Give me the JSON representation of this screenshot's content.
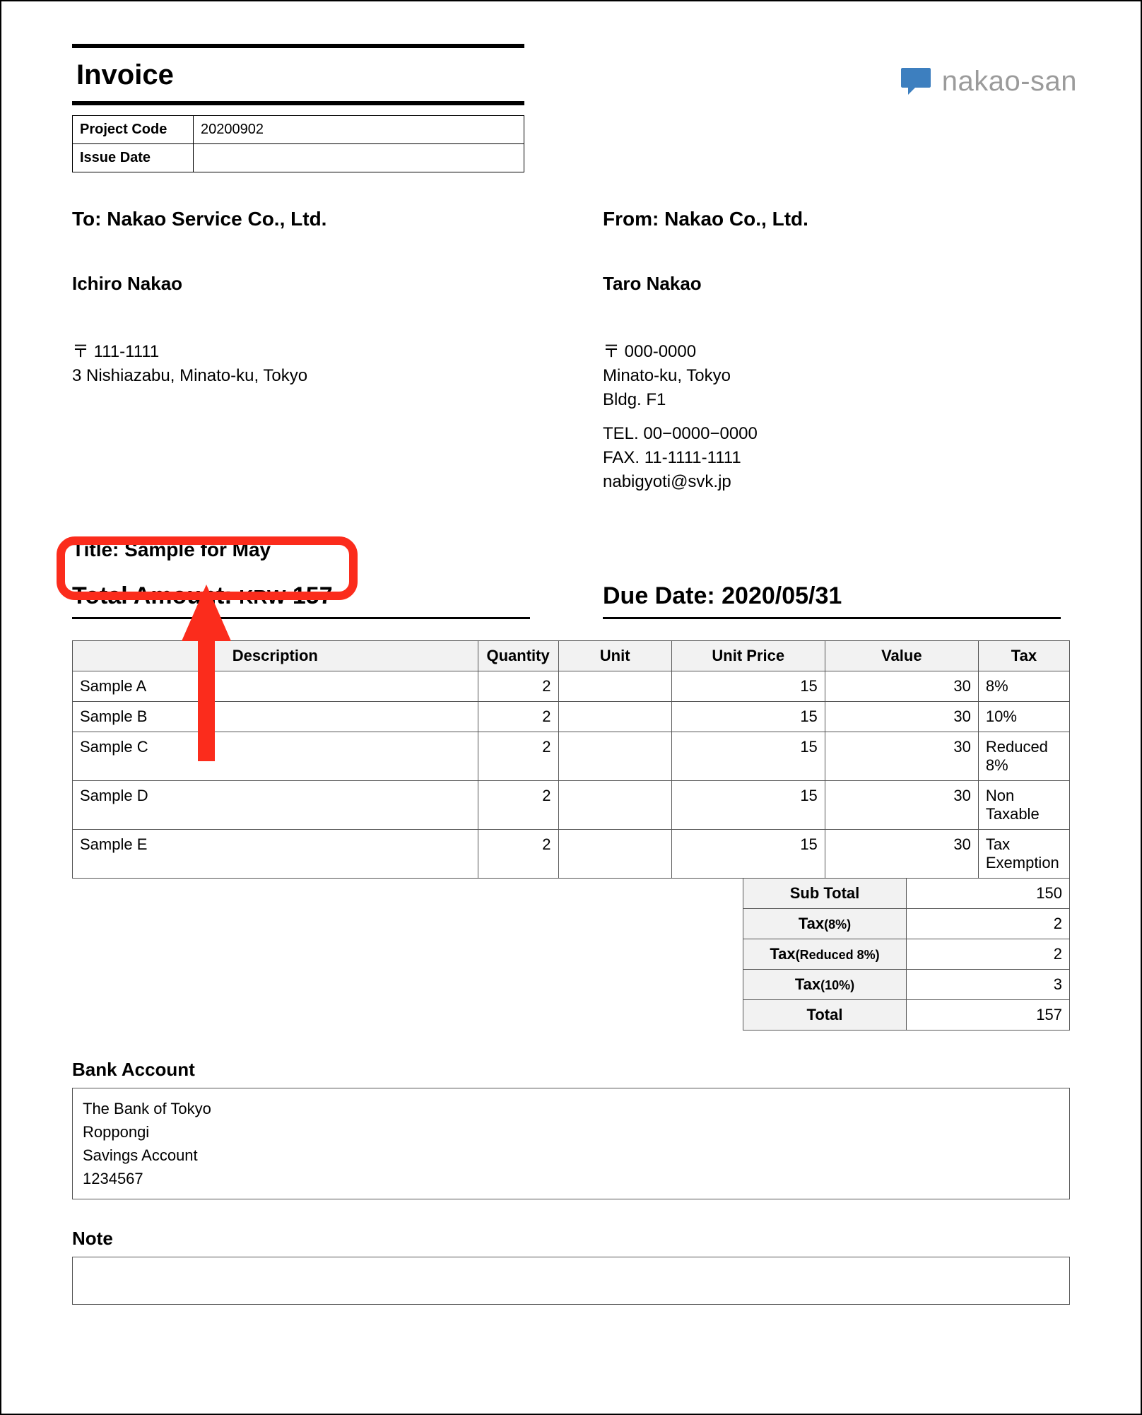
{
  "brand": {
    "icon_name": "speech-bubble-icon",
    "name": "nakao-san"
  },
  "doc_title": "Invoice",
  "meta": {
    "project_code_label": "Project Code",
    "project_code_value": "20200902",
    "issue_date_label": "Issue Date",
    "issue_date_value": ""
  },
  "to": {
    "heading": "To: Nakao Service Co., Ltd.",
    "attn": "Ichiro Nakao",
    "postal": "〒 111-1111",
    "address": "3 Nishiazabu, Minato-ku, Tokyo"
  },
  "from": {
    "heading": "From: Nakao Co., Ltd.",
    "attn": "Taro Nakao",
    "postal": "〒 000-0000",
    "address1": "Minato-ku, Tokyo",
    "address2": "Bldg. F1",
    "tel": "TEL. 00−0000−0000",
    "fax": "FAX. 11-1111-1111",
    "email": "nabigyoti@svk.jp"
  },
  "title_line": {
    "label": "Title: ",
    "value": "Sample for May"
  },
  "summary": {
    "total_label": "Total Amount: ",
    "currency": "KRW",
    "total_amount": "157",
    "due_label": "Due Date: ",
    "due_value": "2020/05/31"
  },
  "table": {
    "headers": {
      "description": "Description",
      "quantity": "Quantity",
      "unit": "Unit",
      "unit_price": "Unit Price",
      "value": "Value",
      "tax": "Tax"
    },
    "rows": [
      {
        "desc": "Sample A",
        "qty": "2",
        "unit": "",
        "price": "15",
        "value": "30",
        "tax": "8%"
      },
      {
        "desc": "Sample B",
        "qty": "2",
        "unit": "",
        "price": "15",
        "value": "30",
        "tax": "10%"
      },
      {
        "desc": "Sample C",
        "qty": "2",
        "unit": "",
        "price": "15",
        "value": "30",
        "tax": "Reduced 8%"
      },
      {
        "desc": "Sample D",
        "qty": "2",
        "unit": "",
        "price": "15",
        "value": "30",
        "tax": "Non Taxable"
      },
      {
        "desc": "Sample E",
        "qty": "2",
        "unit": "",
        "price": "15",
        "value": "30",
        "tax": "Tax Exemption"
      }
    ]
  },
  "totals": {
    "subtotal_label": "Sub Total",
    "subtotal_value": "150",
    "tax8_label": "Tax",
    "tax8_sub": "(8%)",
    "tax8_value": "2",
    "taxr8_label": "Tax",
    "taxr8_sub": "(Reduced 8%)",
    "taxr8_value": "2",
    "tax10_label": "Tax",
    "tax10_sub": "(10%)",
    "tax10_value": "3",
    "total_label": "Total",
    "total_value": "157"
  },
  "bank": {
    "heading": "Bank Account",
    "line1": "The Bank of Tokyo",
    "line2": "Roppongi",
    "line3": "Savings Account",
    "line4": "1234567"
  },
  "note_heading": "Note",
  "note_body": ""
}
